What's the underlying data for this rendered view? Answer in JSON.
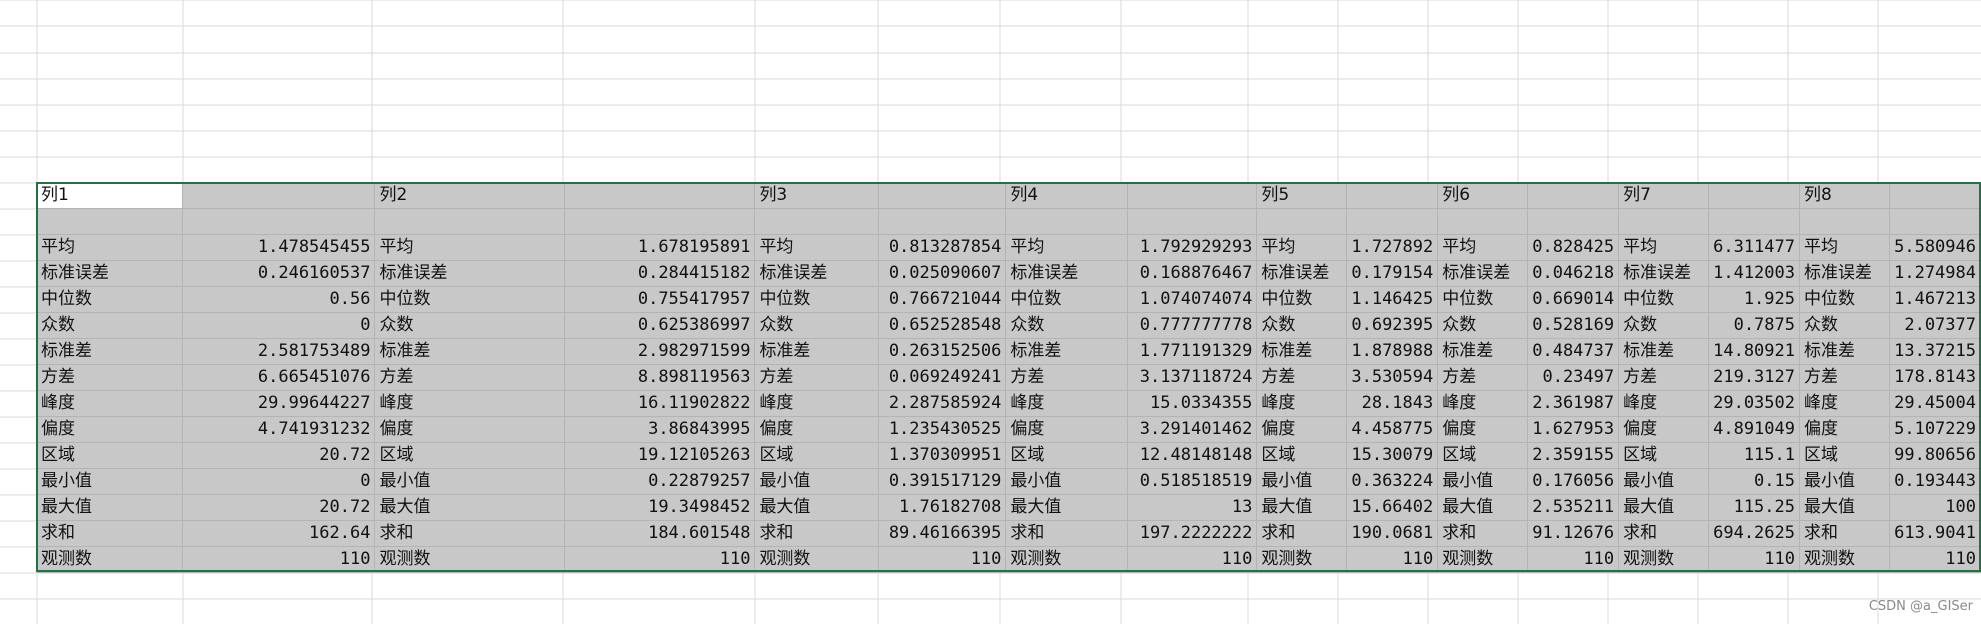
{
  "sheet": {
    "columns": [
      {
        "header": "列1",
        "values": [
          "1.478545455",
          "0.246160537",
          "0.56",
          "0",
          "2.581753489",
          "6.665451076",
          "29.99644227",
          "4.741931232",
          "20.72",
          "0",
          "20.72",
          "162.64",
          "110"
        ]
      },
      {
        "header": "列2",
        "values": [
          "1.678195891",
          "0.284415182",
          "0.755417957",
          "0.625386997",
          "2.982971599",
          "8.898119563",
          "16.11902822",
          "3.86843995",
          "19.12105263",
          "0.22879257",
          "19.3498452",
          "184.601548",
          "110"
        ]
      },
      {
        "header": "列3",
        "values": [
          "0.813287854",
          "0.025090607",
          "0.766721044",
          "0.652528548",
          "0.263152506",
          "0.069249241",
          "2.287585924",
          "1.235430525",
          "1.370309951",
          "0.391517129",
          "1.76182708",
          "89.46166395",
          "110"
        ]
      },
      {
        "header": "列4",
        "values": [
          "1.792929293",
          "0.168876467",
          "1.074074074",
          "0.777777778",
          "1.771191329",
          "3.137118724",
          "15.0334355",
          "3.291401462",
          "12.48148148",
          "0.518518519",
          "13",
          "197.2222222",
          "110"
        ]
      },
      {
        "header": "列5",
        "values": [
          "1.727892",
          "0.179154",
          "1.146425",
          "0.692395",
          "1.878988",
          "3.530594",
          "28.1843",
          "4.458775",
          "15.30079",
          "0.363224",
          "15.66402",
          "190.0681",
          "110"
        ]
      },
      {
        "header": "列6",
        "values": [
          "0.828425",
          "0.046218",
          "0.669014",
          "0.528169",
          "0.484737",
          "0.23497",
          "2.361987",
          "1.627953",
          "2.359155",
          "0.176056",
          "2.535211",
          "91.12676",
          "110"
        ]
      },
      {
        "header": "列7",
        "values": [
          "6.311477",
          "1.412003",
          "1.925",
          "0.7875",
          "14.80921",
          "219.3127",
          "29.03502",
          "4.891049",
          "115.1",
          "0.15",
          "115.25",
          "694.2625",
          "110"
        ]
      },
      {
        "header": "列8",
        "values": [
          "5.580946",
          "1.274984",
          "1.467213",
          "2.07377",
          "13.37215",
          "178.8143",
          "29.45004",
          "5.107229",
          "99.80656",
          "0.193443",
          "100",
          "613.9041",
          "110"
        ]
      }
    ],
    "stat_labels": [
      "平均",
      "标准误差",
      "中位数",
      "众数",
      "标准差",
      "方差",
      "峰度",
      "偏度",
      "区域",
      "最小值",
      "最大值",
      "求和",
      "观测数"
    ]
  },
  "watermark": "CSDN @a_GISer",
  "colors": {
    "selection_border": "#217346",
    "cell_fill": "#c8c8c8",
    "gridline": "#d9d9d9"
  }
}
